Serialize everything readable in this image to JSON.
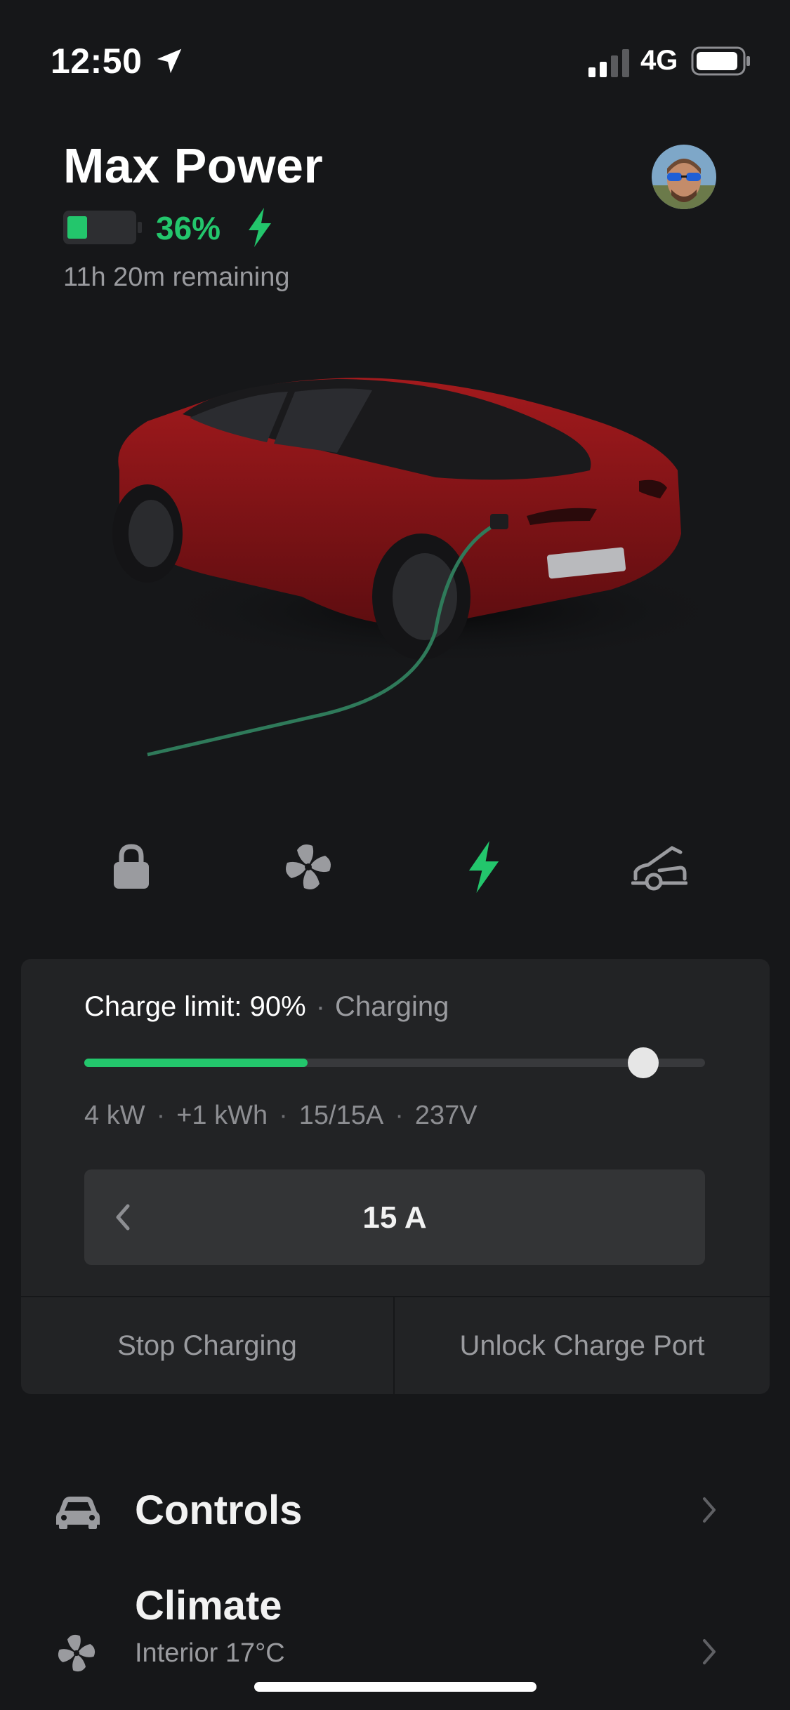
{
  "status_bar": {
    "time": "12:50",
    "network": "4G",
    "location_icon": "location-arrow-icon",
    "signal_icon": "cell-signal-icon",
    "battery_icon": "battery-icon"
  },
  "header": {
    "car_name": "Max Power",
    "battery_percent": "36%",
    "battery_level": 0.36,
    "remaining": "11h 20m remaining",
    "avatar": "profile-avatar"
  },
  "quick_actions": [
    {
      "name": "lock",
      "icon": "lock-icon"
    },
    {
      "name": "climate",
      "icon": "fan-icon"
    },
    {
      "name": "charge",
      "icon": "bolt-icon",
      "active": true
    },
    {
      "name": "frunk",
      "icon": "car-frunk-icon"
    }
  ],
  "charging": {
    "limit_label": "Charge limit: 90%",
    "status": "Charging",
    "current_level": 0.36,
    "limit_level": 0.9,
    "stats": [
      "4 kW",
      "+1 kWh",
      "15/15A",
      "237V"
    ],
    "amps_value": "15 A",
    "stop_label": "Stop Charging",
    "unlock_label": "Unlock Charge Port"
  },
  "menu": {
    "controls": {
      "title": "Controls",
      "icon": "car-icon"
    },
    "climate": {
      "title": "Climate",
      "subtitle": "Interior 17°C",
      "icon": "fan-icon"
    }
  },
  "colors": {
    "background": "#161719",
    "card": "#222325",
    "accent_green": "#23c66c",
    "muted_text": "#9a9b9f",
    "car_red": "#8a1518"
  }
}
